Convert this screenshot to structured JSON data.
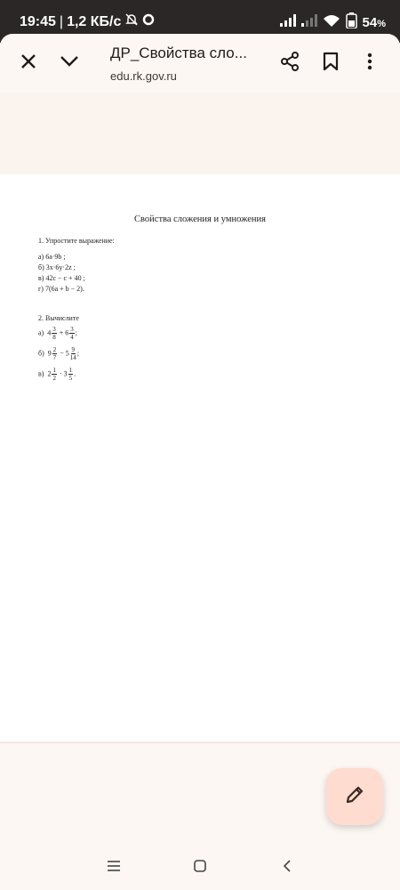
{
  "status_bar": {
    "time": "19:45",
    "speed": "1,2 КБ/с",
    "battery": "54",
    "battery_unit": "%",
    "icons": [
      "mute-bell-icon",
      "sync-icon",
      "signal-icon",
      "signal-icon",
      "wifi-icon",
      "battery-icon"
    ]
  },
  "toolbar": {
    "title": "ДР_Свойства сло...",
    "url": "edu.rk.gov.ru",
    "icons": [
      "close-icon",
      "chevron-down-icon",
      "share-icon",
      "bookmark-icon",
      "more-vert-icon"
    ]
  },
  "document": {
    "heading": "Свойства сложения и умножения",
    "section1": {
      "title": "1. Упростите выражение:",
      "items": [
        "а)  6а·9b ;",
        "б)  3х·6у·2z ;",
        "в)  42с − с + 40 ;",
        "г)  7(6а + b − 2)."
      ]
    },
    "section2": {
      "title": "2. Вычислите",
      "items": [
        {
          "label": "а)",
          "w1": "4",
          "n1": "3",
          "d1": "8",
          "op": "+",
          "w2": "6",
          "n2": "3",
          "d2": "4",
          "end": ";"
        },
        {
          "label": "б)",
          "w1": "9",
          "n1": "2",
          "d1": "7",
          "op": "−",
          "w2": "5",
          "n2": "9",
          "d2": "14",
          "end": ";"
        },
        {
          "label": "в)",
          "w1": "2",
          "n1": "1",
          "d1": "2",
          "op": "·",
          "w2": "3",
          "n2": "1",
          "d2": "5",
          "end": "."
        }
      ]
    }
  },
  "fab": {
    "icon": "edit-pencil-icon"
  },
  "nav": {
    "icons": [
      "menu-icon",
      "home-icon",
      "back-icon"
    ]
  },
  "colors": {
    "status_bg": "#2a2726",
    "surface": "#fdf7f3",
    "page": "#ffffff",
    "fab": "#ffdccf"
  }
}
